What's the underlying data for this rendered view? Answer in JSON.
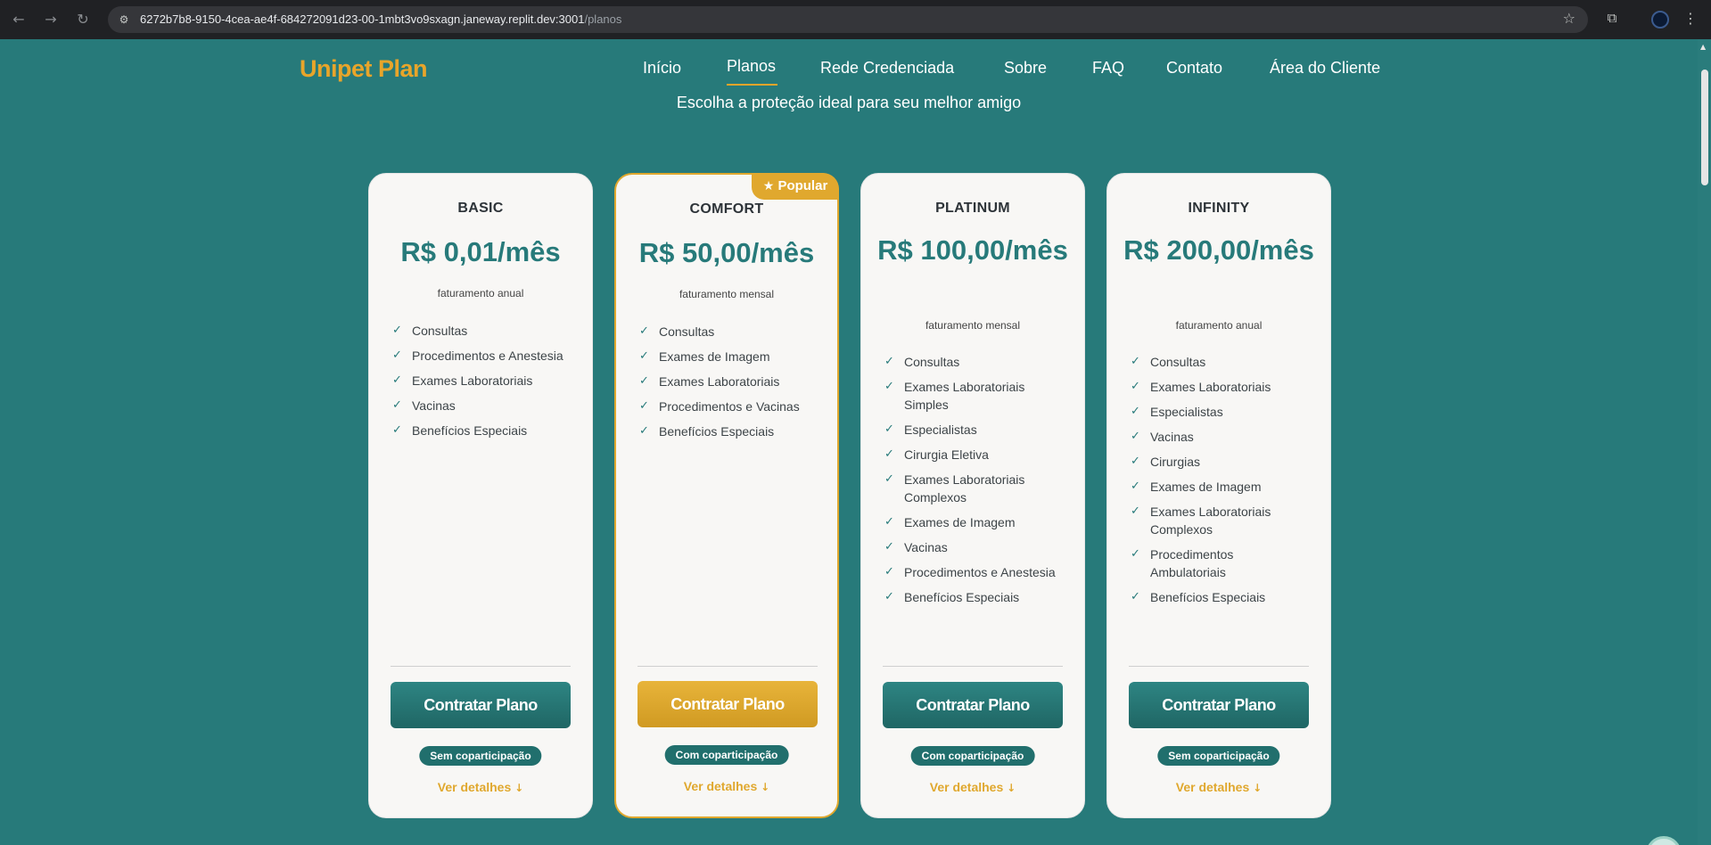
{
  "browser": {
    "url_host": "6272b7b8-9150-4cea-ae4f-684272091d23-00-1mbt3vo9sxagn.janeway.replit.dev:3001",
    "url_path": "/planos"
  },
  "header": {
    "logo": "Unipet Plan",
    "nav": [
      "Início",
      "Planos",
      "Rede Credenciada",
      "Sobre",
      "FAQ",
      "Contato",
      "Área do Cliente"
    ],
    "active_nav": "Planos"
  },
  "subtitle": "Escolha a proteção ideal para seu melhor amigo",
  "colors": {
    "brand": "#277a7a",
    "accent": "#e0a82e",
    "card_bg": "#f8f7f5"
  },
  "plans": [
    {
      "name": "BASIC",
      "price": "R$ 0,01/mês",
      "billing": "faturamento anual",
      "features": [
        "Consultas",
        "Procedimentos e Anestesia",
        "Exames Laboratoriais",
        "Vacinas",
        "Benefícios Especiais"
      ],
      "cta": "Contratar Plano",
      "copay": "Sem coparticipação",
      "details": "Ver detalhes"
    },
    {
      "name": "COMFORT",
      "price": "R$ 50,00/mês",
      "billing": "faturamento mensal",
      "popular": "Popular",
      "features": [
        "Consultas",
        "Exames de Imagem",
        "Exames Laboratoriais",
        "Procedimentos e Vacinas",
        "Benefícios Especiais"
      ],
      "cta": "Contratar Plano",
      "copay": "Com coparticipação",
      "details": "Ver detalhes"
    },
    {
      "name": "PLATINUM",
      "price": "R$ 100,00/mês",
      "billing": "faturamento mensal",
      "features": [
        "Consultas",
        "Exames Laboratoriais Simples",
        "Especialistas",
        "Cirurgia Eletiva",
        "Exames Laboratoriais Complexos",
        "Exames de Imagem",
        "Vacinas",
        "Procedimentos e Anestesia",
        "Benefícios Especiais"
      ],
      "cta": "Contratar Plano",
      "copay": "Com coparticipação",
      "details": "Ver detalhes"
    },
    {
      "name": "INFINITY",
      "price": "R$ 200,00/mês",
      "billing": "faturamento anual",
      "features": [
        "Consultas",
        "Exames Laboratoriais",
        "Especialistas",
        "Vacinas",
        "Cirurgias",
        "Exames de Imagem",
        "Exames Laboratoriais Complexos",
        "Procedimentos Ambulatoriais",
        "Benefícios Especiais"
      ],
      "cta": "Contratar Plano",
      "copay": "Sem coparticipação",
      "details": "Ver detalhes"
    }
  ]
}
